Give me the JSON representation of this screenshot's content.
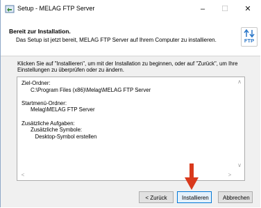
{
  "window": {
    "title": "Setup - MELAG FTP Server",
    "controls": {
      "minimize": "–",
      "maximize": "☐",
      "close": "✕"
    }
  },
  "header": {
    "title": "Bereit zur Installation.",
    "subtitle": "Das Setup ist jetzt bereit, MELAG FTP Server auf Ihrem Computer zu installieren.",
    "logo_text": "FTP"
  },
  "content": {
    "intro": "Klicken Sie auf \"Installieren\", um mit der Installation zu beginnen, oder auf \"Zurück\", um Ihre Einstellungen zu überprüfen oder zu ändern.",
    "memo": "Ziel-Ordner:\n      C:\\Program Files (x86)\\Melag\\MELAG FTP Server\n\nStartmenü-Ordner:\n      Melag\\MELAG FTP Server\n\nZusätzliche Aufgaben:\n      Zusätzliche Symbole:\n         Desktop-Symbol erstellen"
  },
  "buttons": {
    "back": "< Zurück",
    "install": "Installieren",
    "cancel": "Abbrechen"
  },
  "colors": {
    "accent": "#0078d7",
    "annotation_arrow": "#d9391c",
    "logo_blue": "#2b77c8"
  }
}
